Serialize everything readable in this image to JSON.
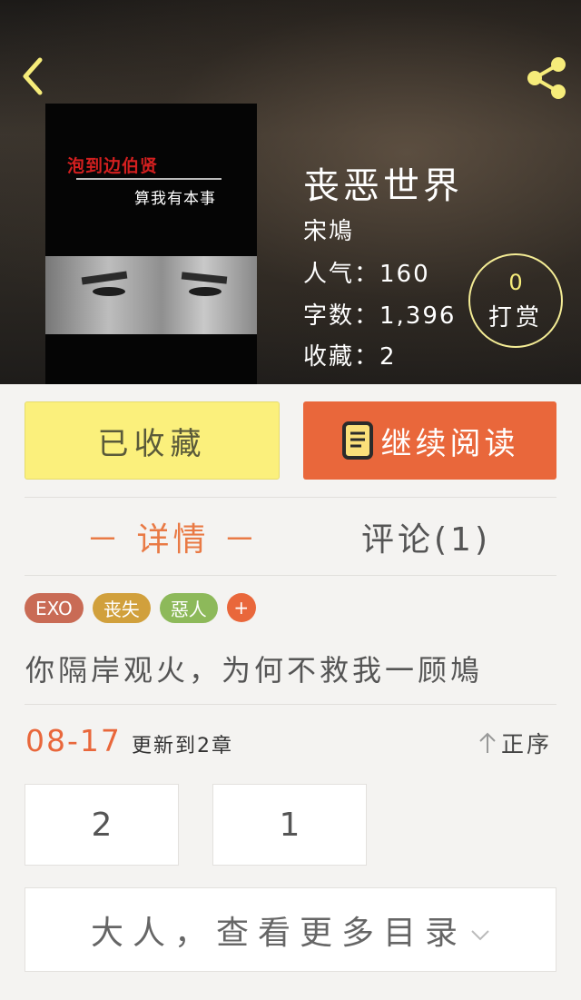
{
  "header": {
    "back_icon": "chevron-left-icon",
    "share_icon": "share-icon",
    "icon_color": "#f6ec7a"
  },
  "cover": {
    "title": "泡到边伯贤",
    "subtitle": "算我有本事"
  },
  "book": {
    "title": "丧恶世界",
    "author": "宋鳩",
    "popularity": "人气：160",
    "word_count": "字数：1,396",
    "favorites": "收藏：2"
  },
  "tip": {
    "count": "0",
    "label": "打赏"
  },
  "actions": {
    "favorited_label": "已收藏",
    "continue_label": "继续阅读"
  },
  "tabs": {
    "details": "－ 详情 －",
    "comments": "评论(1)"
  },
  "tags": [
    {
      "label": "EXO",
      "color": "#c96b55"
    },
    {
      "label": "丧失",
      "color": "#d1a03c"
    },
    {
      "label": "惡人",
      "color": "#8db95a"
    }
  ],
  "tag_add_label": "+",
  "intro": "你隔岸观火，为何不救我一顾鳩",
  "update": {
    "date": "08-17",
    "text": "更新到2章",
    "sort_label": "正序"
  },
  "chapters": [
    "2",
    "1"
  ],
  "more_catalog_label": "大人，查看更多目录"
}
